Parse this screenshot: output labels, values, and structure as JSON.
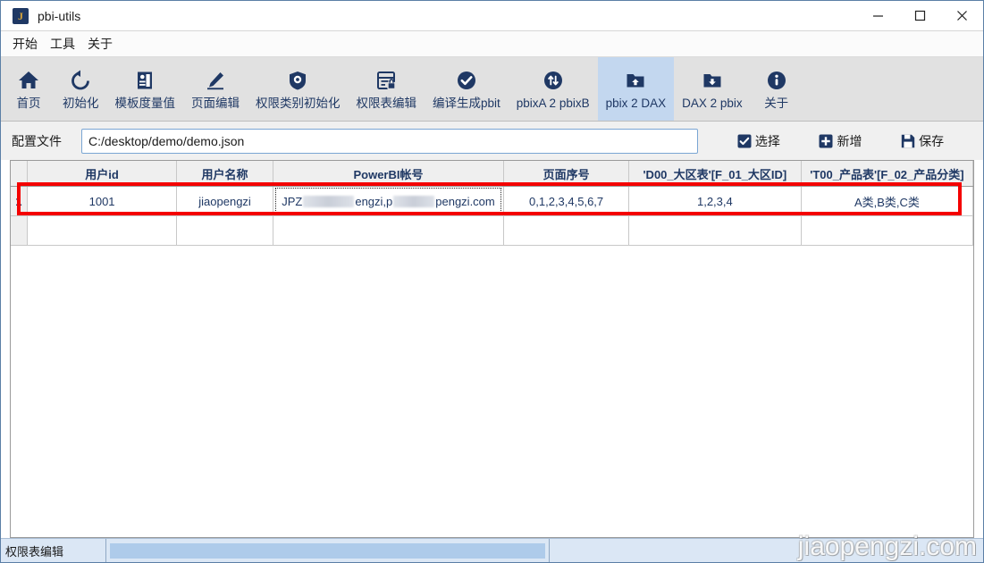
{
  "window": {
    "title": "pbi-utils",
    "app_icon": "J",
    "controls": {
      "minimize": "minimize-icon",
      "maximize": "maximize-icon",
      "close": "close-icon"
    }
  },
  "menu": {
    "items": [
      {
        "label": "开始"
      },
      {
        "label": "工具"
      },
      {
        "label": "关于"
      }
    ]
  },
  "toolbar": {
    "items": [
      {
        "label": "首页",
        "icon": "home-icon",
        "selected": false
      },
      {
        "label": "初始化",
        "icon": "refresh-icon",
        "selected": false
      },
      {
        "label": "模板度量值",
        "icon": "template-measure-icon",
        "selected": false
      },
      {
        "label": "页面编辑",
        "icon": "pencil-icon",
        "selected": false
      },
      {
        "label": "权限类别初始化",
        "icon": "shield-icon",
        "selected": false
      },
      {
        "label": "权限表编辑",
        "icon": "table-lock-icon",
        "selected": false
      },
      {
        "label": "编译生成pbit",
        "icon": "check-circle-icon",
        "selected": false
      },
      {
        "label": "pbixA 2 pbixB",
        "icon": "swap-icon",
        "selected": false
      },
      {
        "label": "pbix 2 DAX",
        "icon": "folder-up-icon",
        "selected": true
      },
      {
        "label": "DAX 2 pbix",
        "icon": "folder-down-icon",
        "selected": false
      },
      {
        "label": "关于",
        "icon": "info-icon",
        "selected": false
      }
    ]
  },
  "config": {
    "label": "配置文件",
    "path_value": "C:/desktop/demo/demo.json",
    "path_placeholder": "",
    "buttons": [
      {
        "label": "选择",
        "icon": "check-box-icon"
      },
      {
        "label": "新增",
        "icon": "plus-box-icon"
      },
      {
        "label": "保存",
        "icon": "save-icon"
      }
    ]
  },
  "table": {
    "row_header": "",
    "columns": [
      "用户id",
      "用户名称",
      "PowerBI帐号",
      "页面序号",
      "'D00_大区表'[F_01_大区ID]",
      "'T00_产品表'[F_02_产品分类]"
    ],
    "rows": [
      {
        "index": "1",
        "user_id": "1001",
        "user_name": "jiaopengzi",
        "powerbi_account_prefix": "JPZ",
        "powerbi_account_mid": "engzi,p",
        "powerbi_account_suffix": "pengzi.com",
        "page_order": "0,1,2,3,4,5,6,7",
        "region_id": "1,2,3,4",
        "product_category": "A类,B类,C类"
      }
    ]
  },
  "status": {
    "text": "权限表编辑",
    "progress": ""
  },
  "watermark": {
    "text": "jiaopengzi.com"
  },
  "colors": {
    "accent": "#1f3864",
    "selected_tab": "#c3d7ef",
    "annotation": "#f40000",
    "statusbar": "#dbe7f5"
  }
}
